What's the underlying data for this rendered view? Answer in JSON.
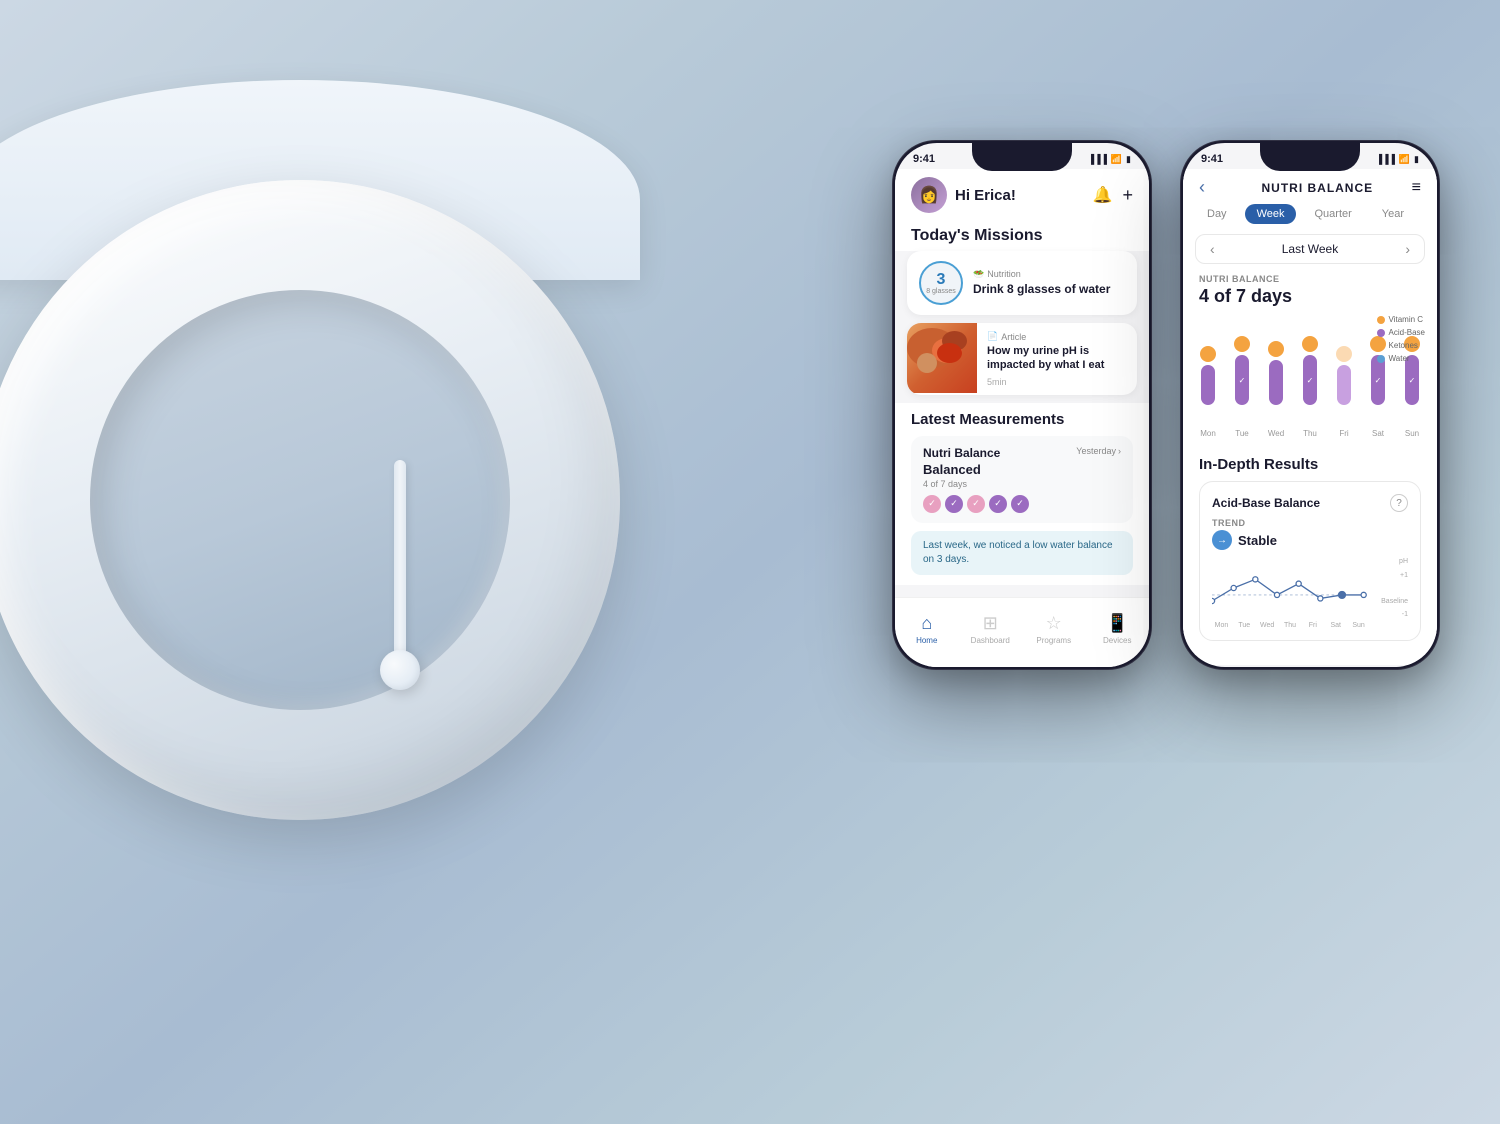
{
  "background": {
    "color_from": "#c8d8e8",
    "color_to": "#d0dce8"
  },
  "phone1": {
    "status_bar": {
      "time": "9:41",
      "signal": "▌▌▌",
      "wifi": "WiFi",
      "battery": "Battery"
    },
    "header": {
      "greeting": "Hi Erica!",
      "bell_icon": "bell",
      "plus_icon": "plus"
    },
    "today_missions": {
      "title": "Today's Missions",
      "missions": [
        {
          "badge_number": "3",
          "badge_sub": "8 glasses",
          "category": "Nutrition",
          "title": "Drink 8 glasses of water"
        }
      ],
      "articles": [
        {
          "category": "Article",
          "title": "How my urine pH is impacted by what I eat",
          "time": "5min"
        }
      ]
    },
    "latest_measurements": {
      "title": "Latest Measurements",
      "cards": [
        {
          "name": "Nutri Balance",
          "date": "Yesterday",
          "value": "Balanced",
          "sub": "4 of 7 days",
          "dots": [
            "pink-check",
            "purple-check",
            "pink-check",
            "purple-check",
            "purple-check"
          ]
        }
      ],
      "notice": "Last week, we noticed a low water balance on 3 days."
    },
    "bottom_nav": {
      "items": [
        {
          "label": "Home",
          "icon": "🏠",
          "active": true
        },
        {
          "label": "Dashboard",
          "icon": "⊞",
          "active": false
        },
        {
          "label": "Programs",
          "icon": "☆",
          "active": false
        },
        {
          "label": "Devices",
          "icon": "📱",
          "active": false
        }
      ]
    }
  },
  "phone2": {
    "status_bar": {
      "time": "9:41",
      "signal": "▌▌▌",
      "wifi": "WiFi",
      "battery": "Battery"
    },
    "header": {
      "back_icon": "back",
      "title": "NUTRI BALANCE",
      "menu_icon": "menu"
    },
    "period_tabs": [
      "Day",
      "Week",
      "Quarter",
      "Year"
    ],
    "active_tab": "Week",
    "week_nav": {
      "prev_icon": "chevron-left",
      "label": "Last Week",
      "next_icon": "chevron-right"
    },
    "nutri_balance": {
      "label": "NUTRI BALANCE",
      "value": "4 of 7 days"
    },
    "chart": {
      "days": [
        "Mon",
        "Tue",
        "Wed",
        "Thu",
        "Fri",
        "Sat",
        "Sun"
      ],
      "legend": [
        "Vitamin C",
        "Acid-Base",
        "Ketones",
        "Water"
      ],
      "legend_colors": [
        "#f4a340",
        "#9b6bc0",
        "#f4a340",
        "#5b9fd4"
      ]
    },
    "in_depth": {
      "title": "In-Depth Results",
      "cards": [
        {
          "title": "Acid-Base Balance",
          "trend_label": "TREND",
          "trend_value": "Stable",
          "chart_labels": [
            "Mon",
            "Tue",
            "Wed",
            "Thu",
            "Fri",
            "Sat",
            "Sun"
          ],
          "ph_label": "pH",
          "baseline_label": "Baseline"
        }
      ]
    }
  }
}
